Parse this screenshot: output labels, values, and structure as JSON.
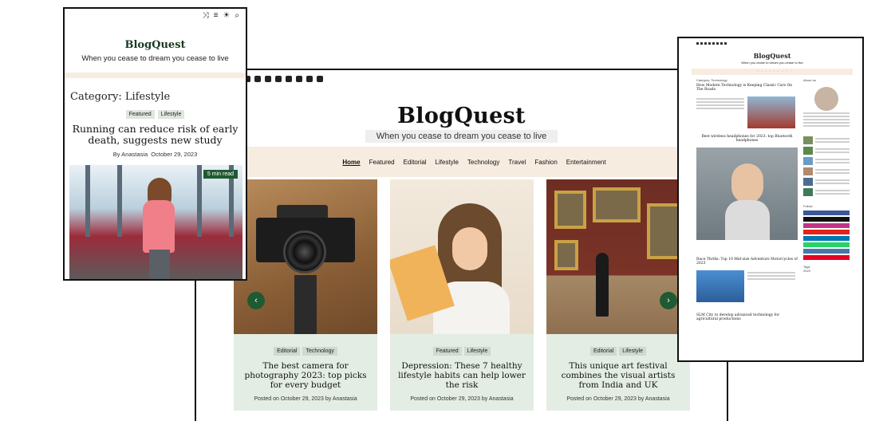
{
  "desktop": {
    "brand": "BlogQuest",
    "tagline": "When you cease to dream you cease to live",
    "nav": [
      "Home",
      "Featured",
      "Editorial",
      "Lifestyle",
      "Technology",
      "Travel",
      "Fashion",
      "Entertainment"
    ],
    "slides": [
      {
        "tags": [
          "Editorial",
          "Technology"
        ],
        "title": "The best camera for photography 2023: top picks for every budget",
        "posted": "Posted on",
        "date": "October 29, 2023",
        "by": "by",
        "author": "Anastasia"
      },
      {
        "tags": [
          "Featured",
          "Lifestyle"
        ],
        "title": "Depression: These 7 healthy lifestyle habits can help lower the risk",
        "posted": "Posted on",
        "date": "October 29, 2023",
        "by": "by",
        "author": "Anastasia"
      },
      {
        "tags": [
          "Editorial",
          "Lifestyle"
        ],
        "title": "This unique art festival combines the visual artists from India and UK",
        "posted": "Posted on",
        "date": "October 29, 2023",
        "by": "by",
        "author": "Anastasia"
      }
    ],
    "prev": "‹",
    "next": "›"
  },
  "mobile": {
    "brand": "BlogQuest",
    "tagline": "When you cease to dream you cease to live",
    "category": "Category: Lifestyle",
    "tags": [
      "Featured",
      "Lifestyle"
    ],
    "title": "Running can reduce risk of early death, suggests new study",
    "by": "By",
    "author": "Anastasia",
    "date": "October 29, 2023",
    "badge": "5 min read",
    "icons": [
      "⤨",
      "≡",
      "☀",
      "⌕"
    ]
  },
  "right": {
    "brand": "BlogQuest",
    "tagline": "When you cease to dream you cease to live",
    "category": "Category: Technology",
    "post1": "How Modern Technology is Keeping Classic Cars On The Roads",
    "post2": "Best wireless headphones for 2023: top Bluetooth headphones",
    "post3": "Race Thrills: Top 10 Mid-size Adventure Motorcycles of 2023",
    "post4": "SLM City to develop advanced technology for agricultural productions",
    "about": "About us",
    "follow": "Follow",
    "tags_label": "Tags",
    "year": "2023"
  },
  "colors": {
    "accent": "#1f5a32",
    "nav_band": "#f7ece0",
    "card_bg": "#e4ede3"
  }
}
